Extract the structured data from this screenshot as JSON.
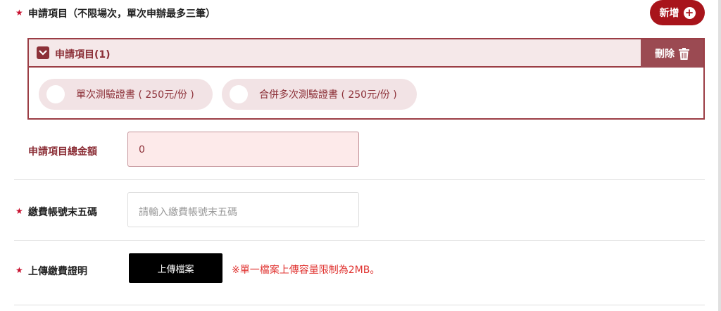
{
  "section": {
    "required_mark": "★",
    "title": "申請項目（不限場次，單次申辦最多三筆）",
    "add_label": "新增",
    "add_icon": "plus-circle-icon"
  },
  "item": {
    "title": "申請項目(1)",
    "checkbox_icon": "chevron-down-icon",
    "delete_label": "刪除",
    "delete_icon": "trash-icon",
    "options": [
      {
        "label": "單次測驗證書 ( 250元/份 )"
      },
      {
        "label": "合併多次測驗證書 ( 250元/份 )"
      }
    ]
  },
  "total": {
    "label": "申請項目總金額",
    "value": "0"
  },
  "account": {
    "required_mark": "★",
    "label": "繳費帳號末五碼",
    "placeholder": "請輸入繳費帳號末五碼"
  },
  "upload": {
    "required_mark": "★",
    "label": "上傳繳費證明",
    "button_label": "上傳檔案",
    "note": "※單一檔案上傳容量限制為2MB。"
  },
  "colors": {
    "brand": "#a8141b",
    "maroon": "#8c3038",
    "warning": "#e0322f"
  }
}
